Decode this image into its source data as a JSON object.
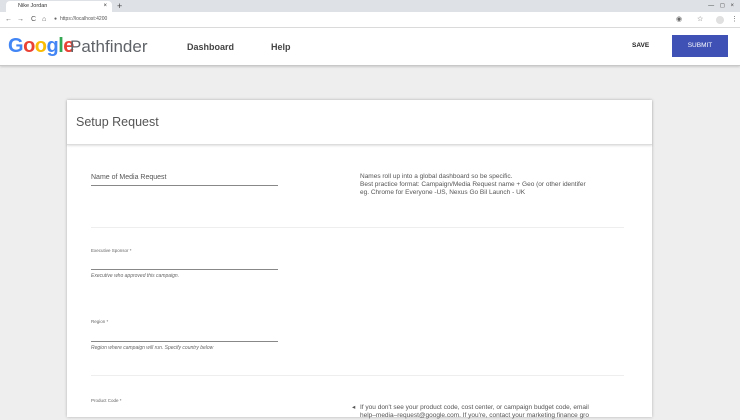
{
  "browser": {
    "tab_title": "Nike Jordan",
    "tab_close": "×",
    "new_tab": "+",
    "window_controls": "— ◻ ×",
    "url": "https://localhost:4200",
    "back": "←",
    "forward": "→",
    "reload": "C",
    "home": "⌂"
  },
  "header": {
    "logo": [
      "G",
      "o",
      "o",
      "g",
      "l",
      "e"
    ],
    "product": "Pathfinder",
    "nav": [
      "Dashboard",
      "Help"
    ],
    "save_label": "SAVE",
    "submit_label": "SUBMIT"
  },
  "card": {
    "title": "Setup Request",
    "media_request": {
      "label": "Name of Media Request",
      "help": [
        "Names roll up into a global dashboard so be specific.",
        "Best practice format: Campaign/Media Request name + Geo (or other identifer",
        "eg. Chrome for Everyone -US, Nexus Go Bil Launch - UK"
      ]
    },
    "executive_sponsor": {
      "label": "Executive Sponsor *",
      "hint": "Executive who approved this campaign."
    },
    "region": {
      "label": "Region *",
      "hint": "Region where campaign will run. Specify country below"
    },
    "product_code": {
      "label": "Product Code *",
      "help": [
        "If you don't see your product code, cost center, or campaign budget code, email",
        "help–media–request@google.com. If you're, contact your marketing finance gro"
      ]
    }
  },
  "colors": {
    "submit_bg": "#3f51b5",
    "google_blue": "#4285f4",
    "google_red": "#ea4335",
    "google_yellow": "#fbbc05",
    "google_green": "#34a853"
  }
}
